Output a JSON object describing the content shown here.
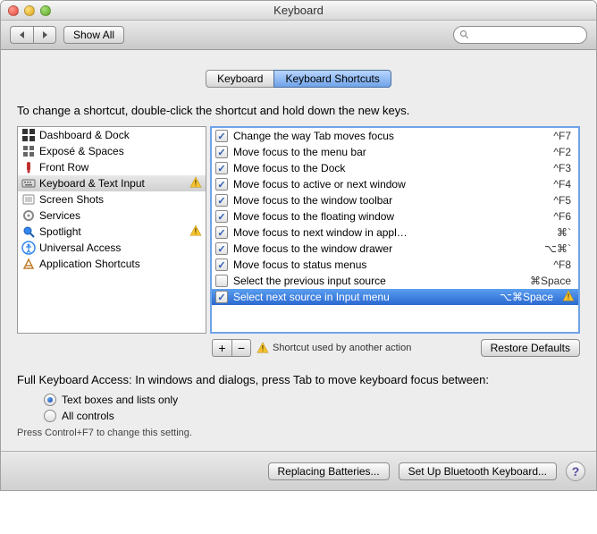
{
  "window": {
    "title": "Keyboard"
  },
  "toolbar": {
    "show_all": "Show All",
    "search_placeholder": ""
  },
  "tabs": {
    "keyboard": "Keyboard",
    "shortcuts": "Keyboard Shortcuts"
  },
  "instruction": "To change a shortcut, double-click the shortcut and hold down the new keys.",
  "categories": [
    {
      "label": "Dashboard & Dock",
      "icon": "dashboard",
      "warn": false,
      "selected": false
    },
    {
      "label": "Exposé & Spaces",
      "icon": "expose",
      "warn": false,
      "selected": false
    },
    {
      "label": "Front Row",
      "icon": "frontrow",
      "warn": false,
      "selected": false
    },
    {
      "label": "Keyboard & Text Input",
      "icon": "keyboard",
      "warn": true,
      "selected": true
    },
    {
      "label": "Screen Shots",
      "icon": "screenshot",
      "warn": false,
      "selected": false
    },
    {
      "label": "Services",
      "icon": "services",
      "warn": false,
      "selected": false
    },
    {
      "label": "Spotlight",
      "icon": "spotlight",
      "warn": true,
      "selected": false
    },
    {
      "label": "Universal Access",
      "icon": "universal",
      "warn": false,
      "selected": false
    },
    {
      "label": "Application Shortcuts",
      "icon": "apps",
      "warn": false,
      "selected": false
    }
  ],
  "shortcuts": [
    {
      "checked": true,
      "label": "Change the way Tab moves focus",
      "key": "^F7",
      "warn": false,
      "selected": false
    },
    {
      "checked": true,
      "label": "Move focus to the menu bar",
      "key": "^F2",
      "warn": false,
      "selected": false
    },
    {
      "checked": true,
      "label": "Move focus to the Dock",
      "key": "^F3",
      "warn": false,
      "selected": false
    },
    {
      "checked": true,
      "label": "Move focus to active or next window",
      "key": "^F4",
      "warn": false,
      "selected": false
    },
    {
      "checked": true,
      "label": "Move focus to the window toolbar",
      "key": "^F5",
      "warn": false,
      "selected": false
    },
    {
      "checked": true,
      "label": "Move focus to the floating window",
      "key": "^F6",
      "warn": false,
      "selected": false
    },
    {
      "checked": true,
      "label": "Move focus to next window in appl…",
      "key": "⌘`",
      "warn": false,
      "selected": false
    },
    {
      "checked": true,
      "label": "Move focus to the window drawer",
      "key": "⌥⌘`",
      "warn": false,
      "selected": false
    },
    {
      "checked": true,
      "label": "Move focus to status menus",
      "key": "^F8",
      "warn": false,
      "selected": false
    },
    {
      "checked": false,
      "label": "Select the previous input source",
      "key": "⌘Space",
      "warn": false,
      "selected": false
    },
    {
      "checked": true,
      "label": "Select next source in Input menu",
      "key": "⌥⌘Space",
      "warn": true,
      "selected": true
    }
  ],
  "plus_minus": {
    "plus": "+",
    "minus": "−"
  },
  "warn_message": "Shortcut used by another action",
  "restore_defaults": "Restore Defaults",
  "fka_label": "Full Keyboard Access: In windows and dialogs, press Tab to move keyboard focus between:",
  "fka_options": {
    "text_boxes": "Text boxes and lists only",
    "all": "All controls"
  },
  "fka_hint": "Press Control+F7 to change this setting.",
  "footer": {
    "batteries": "Replacing Batteries...",
    "bluetooth": "Set Up Bluetooth Keyboard..."
  }
}
